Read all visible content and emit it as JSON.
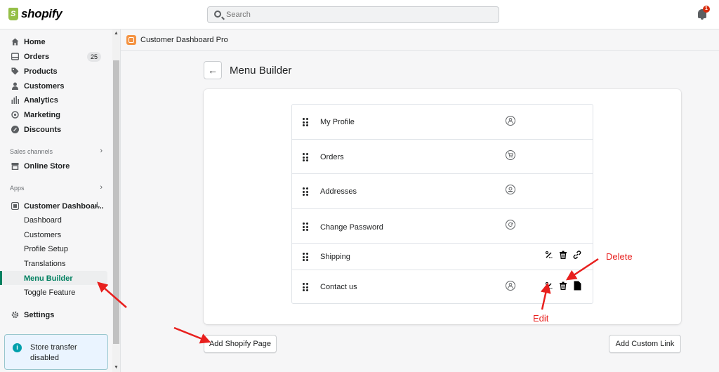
{
  "topbar": {
    "brand": "shopify",
    "search_placeholder": "Search",
    "notification_count": "1"
  },
  "sidebar": {
    "main_items": [
      {
        "label": "Home",
        "icon": "home-icon"
      },
      {
        "label": "Orders",
        "icon": "orders-icon",
        "badge": "25"
      },
      {
        "label": "Products",
        "icon": "tag-icon"
      },
      {
        "label": "Customers",
        "icon": "person-icon"
      },
      {
        "label": "Analytics",
        "icon": "bar-chart-icon"
      },
      {
        "label": "Marketing",
        "icon": "target-icon"
      },
      {
        "label": "Discounts",
        "icon": "discount-icon"
      }
    ],
    "sales_channels_heading": "Sales channels",
    "online_store": "Online Store",
    "apps_heading": "Apps",
    "app_name": "Customer Dashboar...",
    "app_sub_items": [
      "Dashboard",
      "Customers",
      "Profile Setup",
      "Translations",
      "Menu Builder",
      "Toggle Feature"
    ],
    "active_sub_item": "Menu Builder",
    "settings": "Settings",
    "transfer_notice": "Store transfer disabled"
  },
  "app_header": {
    "title": "Customer Dashboard Pro"
  },
  "page": {
    "title": "Menu Builder",
    "back_label": "←"
  },
  "menu_items": [
    {
      "label": "My Profile",
      "icon": "person-circle-icon"
    },
    {
      "label": "Orders",
      "icon": "cart-circle-icon"
    },
    {
      "label": "Addresses",
      "icon": "address-circle-icon"
    },
    {
      "label": "Change Password",
      "icon": "refresh-circle-icon"
    },
    {
      "label": "Shipping",
      "icon": "",
      "actions": [
        "edit",
        "delete",
        "link"
      ]
    },
    {
      "label": "Contact us",
      "icon": "person-circle-icon",
      "actions": [
        "edit",
        "delete",
        "page"
      ]
    }
  ],
  "buttons": {
    "add_shopify_page": "Add Shopify Page",
    "add_custom_link": "Add Custom Link"
  },
  "annotations": {
    "delete_label": "Delete",
    "edit_label": "Edit",
    "color": "#e8201e"
  },
  "colors": {
    "accent": "#008060",
    "brand": "#95bf47",
    "app_icon": "#f49342"
  }
}
